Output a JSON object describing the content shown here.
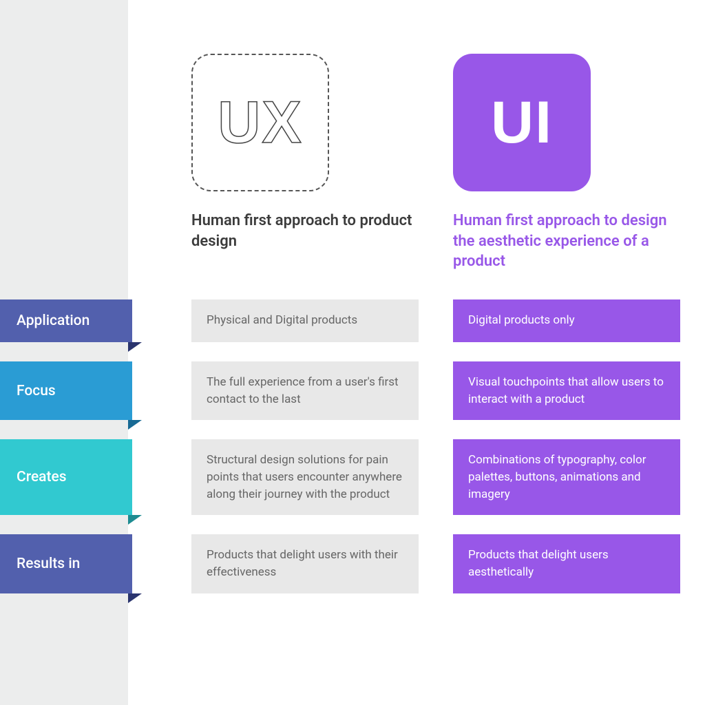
{
  "header": {
    "ux": {
      "badge": "UX",
      "subtitle": "Human first approach to product design"
    },
    "ui": {
      "badge": "UI",
      "subtitle": "Human first approach to design the aesthetic experience of a product"
    }
  },
  "rows": [
    {
      "label": "Application",
      "ux": "Physical and Digital products",
      "ui": "Digital products only"
    },
    {
      "label": "Focus",
      "ux": "The full experience from a user's first contact to the last",
      "ui": "Visual touchpoints that allow users to interact with a product"
    },
    {
      "label": "Creates",
      "ux": "Structural design solutions for pain points that users encounter anywhere along their journey with the product",
      "ui": "Combinations of typography, color palettes, buttons, animations and imagery"
    },
    {
      "label": "Results in",
      "ux": "Products that delight users with their effectiveness",
      "ui": "Products that delight users aesthetically"
    }
  ],
  "colors": {
    "ui_accent": "#9857e8",
    "row_labels": [
      "#5260ad",
      "#2a9cd4",
      "#31c9d0",
      "#5260ad"
    ]
  }
}
